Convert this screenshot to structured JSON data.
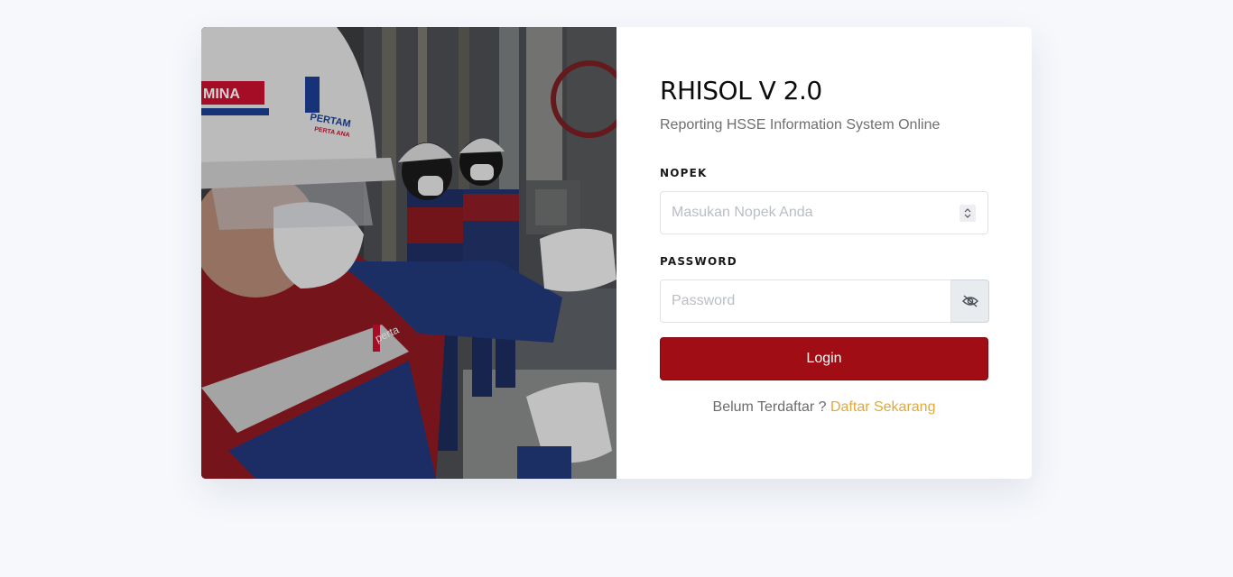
{
  "app": {
    "title": "RHISOL V 2.0",
    "subtitle": "Reporting HSSE Information System Online"
  },
  "form": {
    "nopek_label": "NOPEK",
    "nopek_placeholder": "Masukan Nopek Anda",
    "password_label": "PASSWORD",
    "password_placeholder": "Password",
    "login_label": "Login"
  },
  "register": {
    "prompt": "Belum Terdaftar ?",
    "link_label": "Daftar Sekarang"
  },
  "photo": {
    "helmet_text_1": "MINA",
    "helmet_text_2": "PERTAM",
    "helmet_text_3": "PERTA ANA",
    "jacket_text": "perta"
  },
  "colors": {
    "background": "#f6f8fc",
    "login_button": "#a00d14",
    "link": "#e0a93b",
    "pertamina_red": "#c8102e",
    "pertamina_blue": "#1c3f94"
  },
  "icons": {
    "password_toggle": "eye-slash-icon",
    "stepper": "up-down-chevron-icon"
  }
}
